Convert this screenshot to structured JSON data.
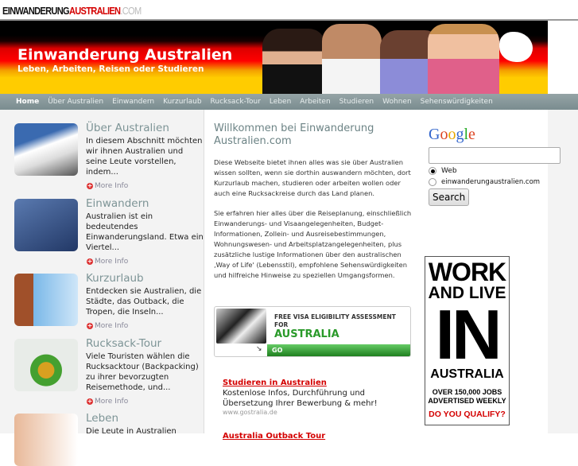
{
  "logo": {
    "part1": "EINWANDERUNG",
    "part2": "AUSTRALIEN",
    "part3": ".COM"
  },
  "banner": {
    "title": "Einwanderung Australien",
    "subtitle": "Leben, Arbeiten, Reisen oder Studieren"
  },
  "nav": [
    "Home",
    "Über Australien",
    "Einwandern",
    "Kurzurlaub",
    "Rucksack-Tour",
    "Leben",
    "Arbeiten",
    "Studieren",
    "Wohnen",
    "Sehenswürdigkeiten"
  ],
  "sidebar": {
    "more_label": "More Info",
    "items": [
      {
        "title": "Über Australien",
        "text": "In diesem Abschnitt möchten wir ihnen Australien und seine Leute vorstellen, indem..."
      },
      {
        "title": "Einwandern",
        "text": "Australien ist ein bedeutendes Einwanderungsland. Etwa ein Viertel..."
      },
      {
        "title": "Kurzurlaub",
        "text": "Entdecken sie Australien, die Städte, das Outback, die Tropen, die Inseln..."
      },
      {
        "title": "Rucksack-Tour",
        "text": "Viele Touristen wählen die Rucksacktour (Backpacking) zu ihrer bevorzugten Reisemethode, und..."
      },
      {
        "title": "Leben",
        "text": "Die Leute in Australien"
      }
    ]
  },
  "main": {
    "title": "Willkommen bei Einwanderung Australien.com",
    "p1": "Diese Webseite bietet ihnen alles was sie über Australien wissen sollten, wenn sie dorthin auswandern möchten, dort Kurzurlaub machen, studieren oder arbeiten wollen oder auch eine Rucksackreise durch das Land planen.",
    "p2": "Sie erfahren hier alles über die Reiseplanung, einschließlich Einwanderungs- und Visaangelegenheiten, Budget-Informationen, Zollein- und Ausreisebestimmungen, Wohnungswesen- und Arbeitsplatzangelegenheiten, plus zusätzliche lustige Informationen über den australischen ‚Way of Life' (Lebensstil), empfohlene Sehenswürdigkeiten und hilfreiche Hinweise zu speziellen Umgangsformen."
  },
  "visa_ad": {
    "line1": "FREE VISA ELIGIBILITY ASSESSMENT FOR",
    "line2": "AUSTRALIA",
    "go": "GO"
  },
  "text_ads": [
    {
      "title": "Studieren in Australien",
      "text": "Kostenlose Infos, Durchführung und Übersetzung Ihrer Bewerbung & mehr!",
      "url": "www.gostralia.de"
    },
    {
      "title": "Australia Outback Tour"
    }
  ],
  "google": {
    "logo": "Google",
    "query": "",
    "options": [
      "Web",
      "einwanderungaustralien.com"
    ],
    "selected": "Web",
    "button": "Search"
  },
  "work_ad": {
    "l1": "WORK",
    "l2": "AND LIVE",
    "l3": "IN",
    "l4": "AUSTRALIA",
    "l5": "OVER 150,000 JOBS ADVERTISED WEEKLY",
    "l6": "DO YOU QUALIFY?"
  }
}
